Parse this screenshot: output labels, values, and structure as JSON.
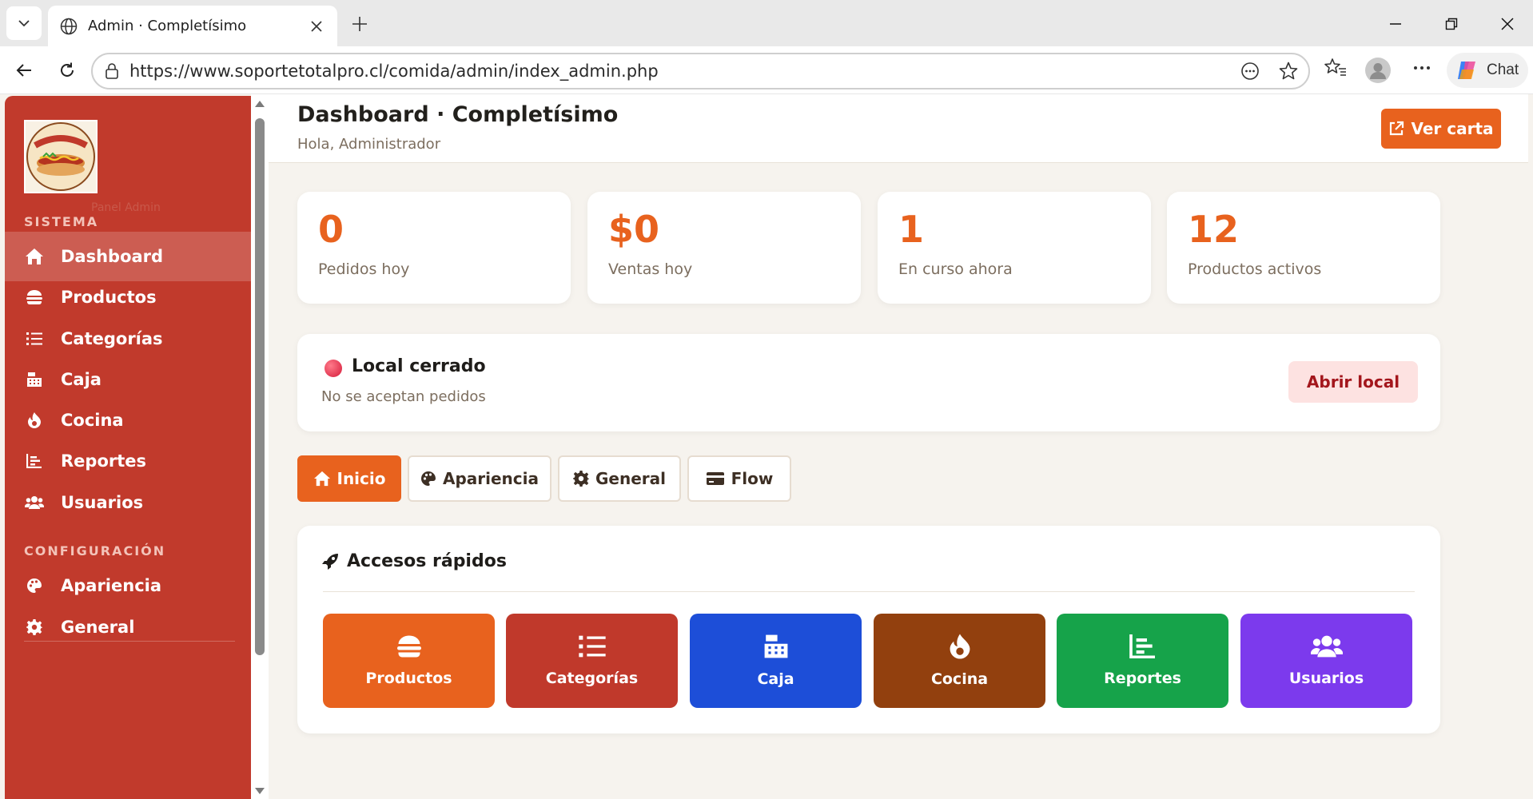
{
  "browser": {
    "tab_title": "Admin · Completísimo",
    "url": "https://www.soportetotalpro.cl/comida/admin/index_admin.php",
    "chat_label": "Chat"
  },
  "sidebar": {
    "logo_sub": "Panel Admin",
    "section_system": "SISTEMA",
    "section_config": "CONFIGURACIÓN",
    "items": [
      {
        "label": "Dashboard",
        "icon": "home-icon",
        "active": true
      },
      {
        "label": "Productos",
        "icon": "burger-icon"
      },
      {
        "label": "Categorías",
        "icon": "list-icon"
      },
      {
        "label": "Caja",
        "icon": "cash-register-icon"
      },
      {
        "label": "Cocina",
        "icon": "fire-icon"
      },
      {
        "label": "Reportes",
        "icon": "chart-icon"
      },
      {
        "label": "Usuarios",
        "icon": "users-icon"
      }
    ],
    "config_items": [
      {
        "label": "Apariencia",
        "icon": "palette-icon"
      },
      {
        "label": "General",
        "icon": "gear-icon"
      }
    ]
  },
  "header": {
    "title": "Dashboard · Completísimo",
    "subtitle": "Hola, Administrador",
    "ver_carta": "Ver carta"
  },
  "stats": [
    {
      "value": "0",
      "label": "Pedidos hoy"
    },
    {
      "value": "$0",
      "label": "Ventas hoy"
    },
    {
      "value": "1",
      "label": "En curso ahora"
    },
    {
      "value": "12",
      "label": "Productos activos"
    }
  ],
  "local": {
    "title": "Local cerrado",
    "subtitle": "No se aceptan pedidos",
    "button": "Abrir local"
  },
  "tabs": [
    {
      "label": "Inicio",
      "icon": "home-icon",
      "active": true
    },
    {
      "label": "Apariencia",
      "icon": "palette-icon"
    },
    {
      "label": "General",
      "icon": "gear-icon"
    },
    {
      "label": "Flow",
      "icon": "credit-card-icon"
    }
  ],
  "quick": {
    "title": "Accesos rápidos",
    "items": [
      {
        "label": "Productos",
        "color": "#e8621e",
        "icon": "burger-icon"
      },
      {
        "label": "Categorías",
        "color": "#c0392b",
        "icon": "list-icon"
      },
      {
        "label": "Caja",
        "color": "#1d4ed8",
        "icon": "cash-register-icon"
      },
      {
        "label": "Cocina",
        "color": "#92400e",
        "icon": "fire-icon"
      },
      {
        "label": "Reportes",
        "color": "#16a34a",
        "icon": "chart-icon"
      },
      {
        "label": "Usuarios",
        "color": "#7c3aed",
        "icon": "users-icon"
      }
    ]
  },
  "colors": {
    "accent": "#e8621e",
    "sidebar": "#c13a2c",
    "background": "#f6f3ee"
  }
}
